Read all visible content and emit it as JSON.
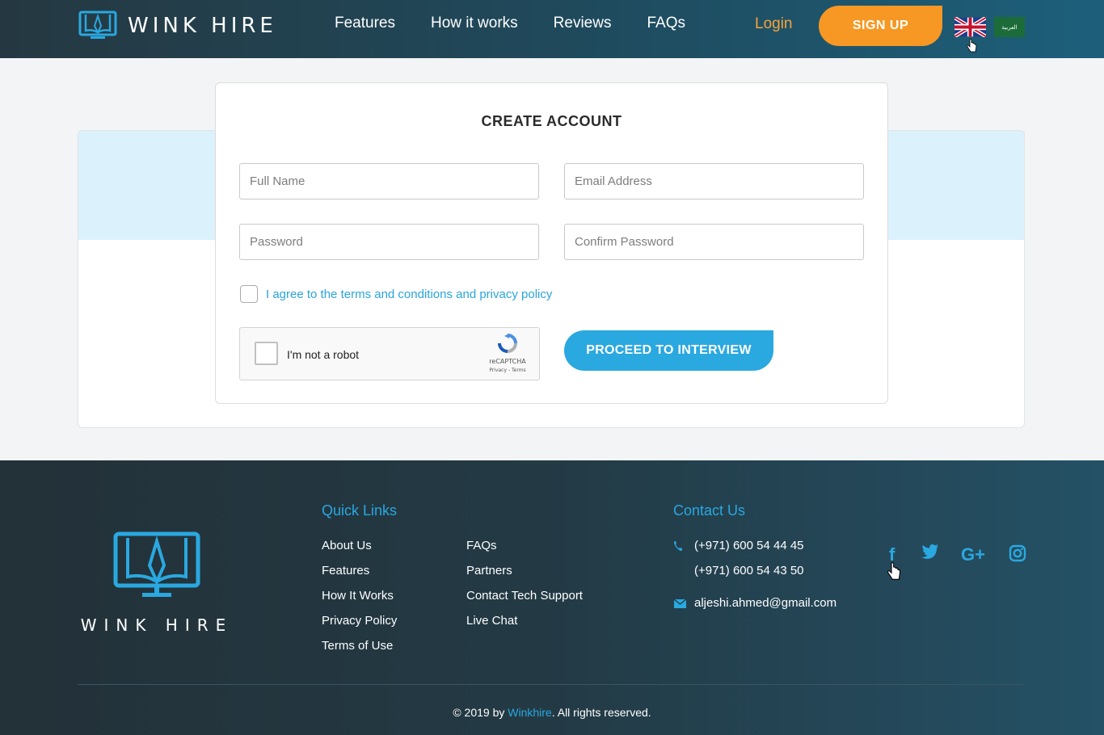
{
  "header": {
    "logo_text": "WINK HIRE",
    "nav": [
      "Features",
      "How it works",
      "Reviews",
      "FAQs"
    ],
    "login": "Login",
    "signup": "SIGN UP",
    "flag_sa_text": "العربية"
  },
  "form": {
    "title": "CREATE ACCOUNT",
    "full_name_placeholder": "Full Name",
    "email_placeholder": "Email Address",
    "password_placeholder": "Password",
    "confirm_password_placeholder": "Confirm Password",
    "agree_text": "I agree to the terms and conditions and privacy policy",
    "captcha_label": "I'm not a robot",
    "captcha_brand": "reCAPTCHA",
    "captcha_terms": "Privacy - Terms",
    "proceed": "PROCEED TO INTERVIEW"
  },
  "footer": {
    "logo_text": "WINK HIRE",
    "quick_links_heading": "Quick Links",
    "links_col1": [
      "About Us",
      "Features",
      "How It Works",
      "Privacy Policy",
      "Terms of Use"
    ],
    "links_col2": [
      "FAQs",
      "Partners",
      "Contact Tech Support",
      "Live Chat"
    ],
    "contact_heading": "Contact Us",
    "phone1": "(+971) 600 54 44 45",
    "phone2": "(+971) 600 54 43 50",
    "email": "aljeshi.ahmed@gmail.com",
    "social": [
      "facebook-icon",
      "twitter-icon",
      "google-plus-icon",
      "instagram-icon"
    ],
    "copyright_prefix": "© 2019 by ",
    "copyright_brand": "Winkhire",
    "copyright_suffix": ". All rights reserved."
  },
  "colors": {
    "accent_blue": "#2aa8e0",
    "accent_orange": "#f69823",
    "header_dark": "#253841"
  }
}
